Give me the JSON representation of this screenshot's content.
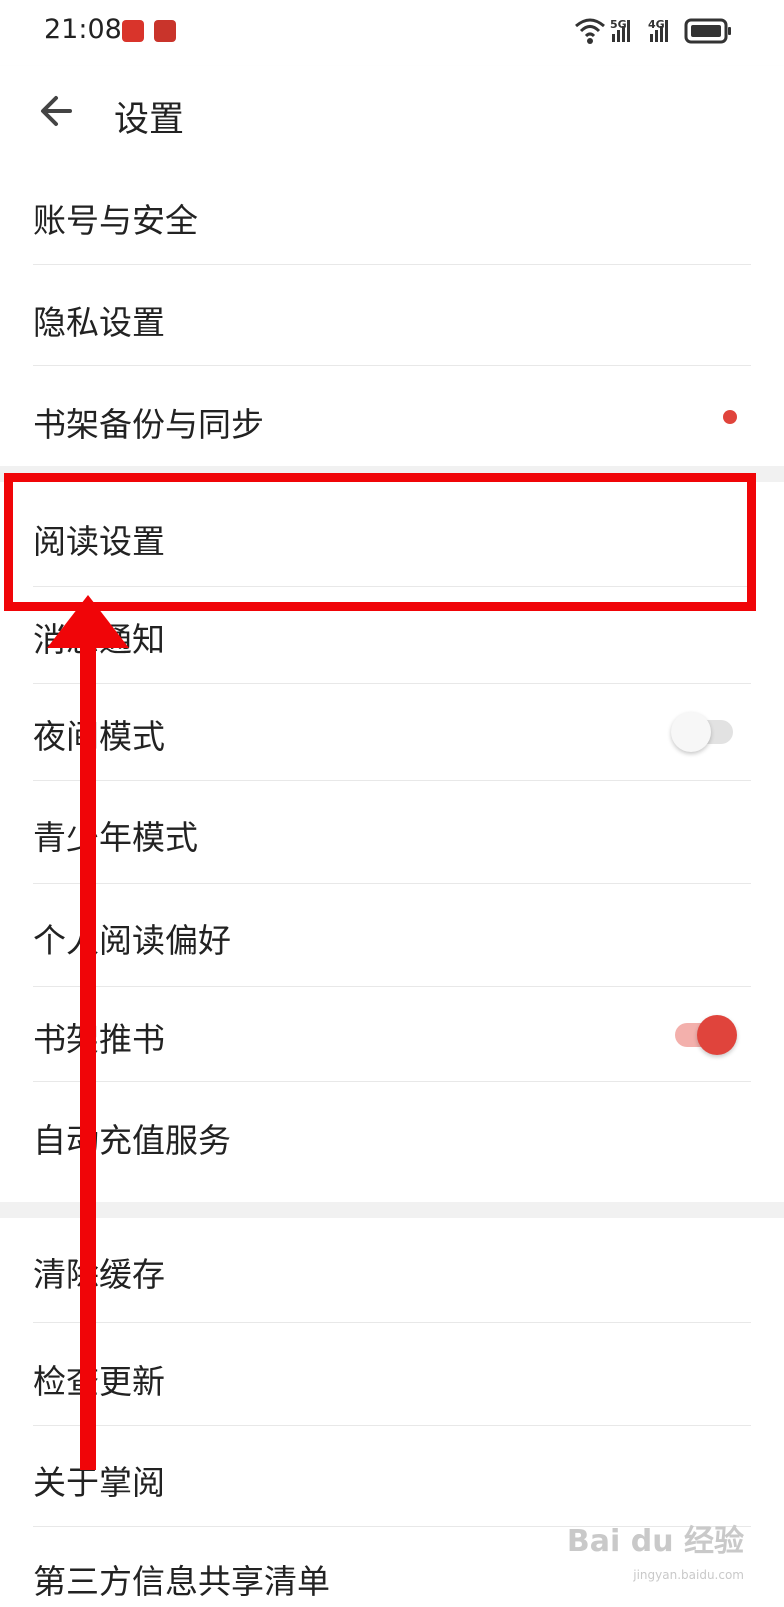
{
  "status_bar": {
    "time": "21:08",
    "network_5g": "5G",
    "network_4g": "4G"
  },
  "header": {
    "back_icon": "arrow-left-icon",
    "title": "设置"
  },
  "sections": [
    {
      "items": [
        {
          "label": "账号与安全"
        },
        {
          "label": "隐私设置"
        },
        {
          "label": "书架备份与同步",
          "indicator": "red-dot"
        }
      ]
    },
    {
      "items": [
        {
          "label": "阅读设置"
        },
        {
          "label": "消息通知"
        },
        {
          "label": "夜间模式",
          "toggle": false
        },
        {
          "label": "青少年模式"
        },
        {
          "label": "个人阅读偏好"
        },
        {
          "label": "书架推书",
          "toggle": true
        },
        {
          "label": "自动充值服务"
        }
      ]
    },
    {
      "items": [
        {
          "label": "清除缓存"
        },
        {
          "label": "检查更新"
        },
        {
          "label": "关于掌阅"
        },
        {
          "label": "第三方信息共享清单"
        }
      ]
    }
  ],
  "colors": {
    "accent": "#e0443c",
    "annotation": "#f00508",
    "divider": "#e8e8e8",
    "section_gap": "#f1f1f1"
  },
  "watermark": {
    "brand": "Bai du 经验",
    "url": "jingyan.baidu.com"
  }
}
